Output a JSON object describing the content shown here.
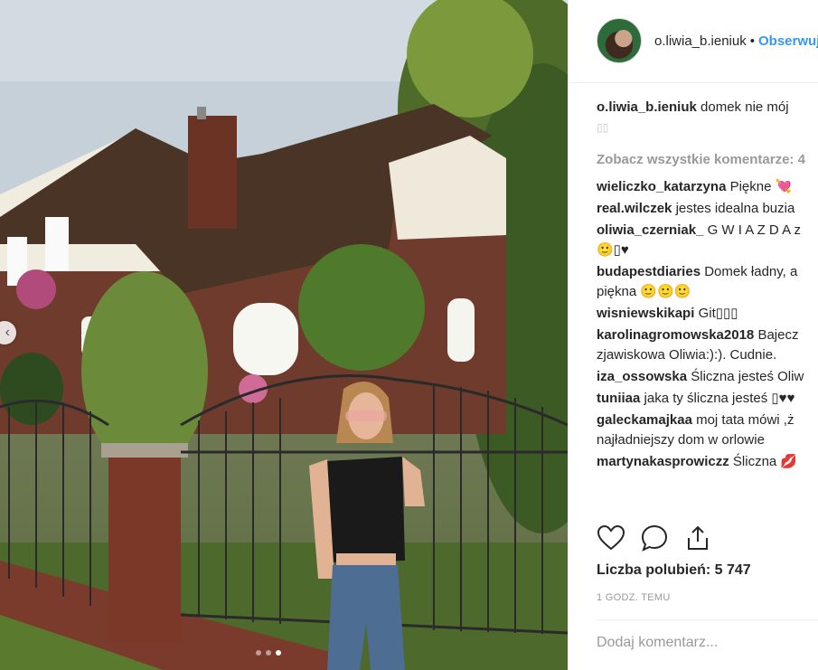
{
  "post": {
    "carousel_dots": 3,
    "active_dot": 2
  },
  "header": {
    "username": "o.liwia_b.ieniuk",
    "separator": "•",
    "follow_label": "Obserwuj"
  },
  "caption": {
    "username": "o.liwia_b.ieniuk",
    "text": "domek nie mój",
    "tail": "▯▯"
  },
  "view_all_comments": "Zobacz wszystkie komentarze: 4",
  "comments": [
    {
      "user": "wieliczko_katarzyna",
      "text": "Piękne 💘"
    },
    {
      "user": "real.wilczek",
      "text": "jestes idealna buzia"
    },
    {
      "user": "oliwia_czerniak_",
      "text": "G W I A Z D A z",
      "line2": "🙂▯♥"
    },
    {
      "user": "budapestdiaries",
      "text": "Domek ładny, a",
      "line2": "piękna 🙂🙂🙂"
    },
    {
      "user": "wisniewskikapi",
      "text": "Git▯▯▯"
    },
    {
      "user": "karolinagromowska2018",
      "text": "Bajecz",
      "line2": "zjawiskowa Oliwia:):). Cudnie."
    },
    {
      "user": "iza_ossowska",
      "text": "Śliczna jesteś Oliw"
    },
    {
      "user": "tuniiaa",
      "text": "jaka ty śliczna jesteś ▯♥♥"
    },
    {
      "user": "galeckamajkaa",
      "text": "moj tata mówi ,ż",
      "line2": "najładniejszy dom w orlowie"
    },
    {
      "user": "martynakasprowiczz",
      "text": "Śliczna 💋"
    }
  ],
  "actions": {
    "like_icon": "heart-icon",
    "comment_icon": "speech-bubble-icon",
    "share_icon": "share-icon"
  },
  "likes_text": "Liczba polubień: 5 747",
  "time_text": "1 GODZ. TEMU",
  "add_comment_placeholder": "Dodaj komentarz...",
  "colors": {
    "link_blue": "#3897f0",
    "text": "#262626",
    "muted": "#999999",
    "border": "#efefef"
  }
}
